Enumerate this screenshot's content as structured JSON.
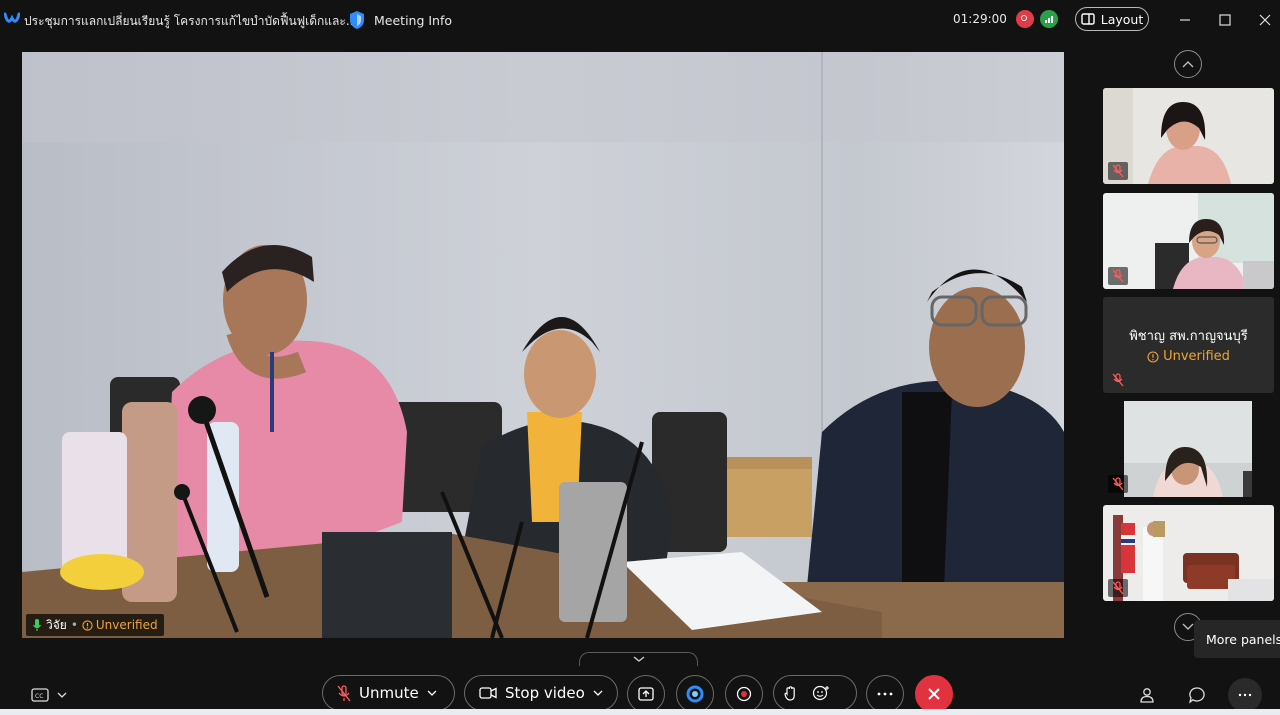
{
  "window": {
    "title": "ประชุมการแลกเปลี่ยนเรียนรู้ โครงการแก้ไขบำบัดฟื้นฟูเด็กและ...",
    "meeting_info": "Meeting Info",
    "timer": "01:29:00",
    "layout_label": "Layout"
  },
  "main_video": {
    "name": "วิจัย",
    "status": "Unverified"
  },
  "participants": [
    {
      "type": "video",
      "muted": true
    },
    {
      "type": "video",
      "muted": true
    },
    {
      "type": "name",
      "name": "พิชาญ สพ.กาญจนบุรี",
      "status": "Unverified",
      "muted": true
    },
    {
      "type": "video",
      "muted": true
    },
    {
      "type": "video",
      "muted": true
    }
  ],
  "tooltip": "More panels",
  "controls": {
    "unmute": "Unmute",
    "stop_video": "Stop video"
  },
  "colors": {
    "background": "#121212",
    "warning": "#f0a43a",
    "leave": "#e2323f",
    "recording": "#e03b48",
    "network": "#2aa148",
    "brand": "#1a73e8"
  }
}
